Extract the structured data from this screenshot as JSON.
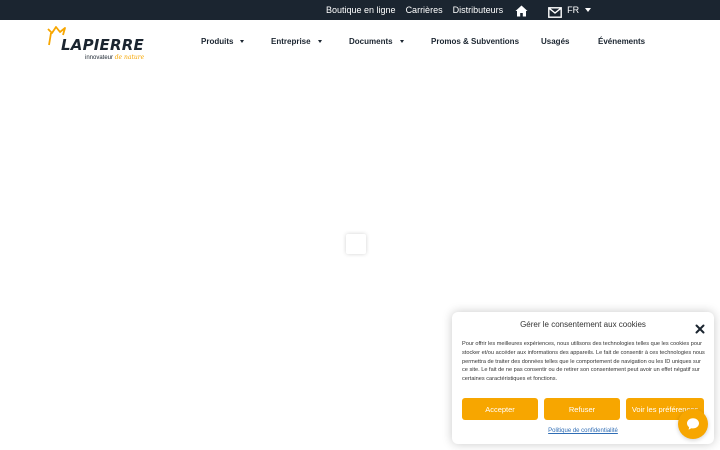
{
  "topbar": {
    "links": [
      "Boutique en ligne",
      "Carrières",
      "Distributeurs"
    ],
    "home_icon": "home-icon",
    "mail_icon": "mail-icon",
    "language": "FR",
    "language_caret_icon": "caret-down-icon"
  },
  "header": {
    "logo": {
      "name": "LAPIERRE",
      "tagline_prefix": "innovateur",
      "tagline_accent": "de nature"
    },
    "nav": {
      "produits": "Produits",
      "entreprise": "Entreprise",
      "documents": "Documents",
      "promos": "Promos & Subventions",
      "usages": "Usagés",
      "evenements": "Événements"
    }
  },
  "cookie_banner": {
    "title": "Gérer le consentement aux cookies",
    "body": "Pour offrir les meilleures expériences, nous utilisons des technologies telles que les cookies pour stocker et/ou accéder aux informations des appareils. Le fait de consentir à ces technologies nous permettra de traiter des données telles que le comportement de navigation ou les ID uniques sur ce site. Le fait de ne pas consentir ou de retirer son consentement peut avoir un effet négatif sur certaines caractéristiques et fonctions.",
    "accept_label": "Accepter",
    "refuse_label": "Refuser",
    "preferences_label": "Voir les préférences",
    "privacy_link": "Politique de confidentialité"
  },
  "colors": {
    "topbar_bg": "#1b2530",
    "accent": "#f7a600",
    "link": "#2f6db5"
  }
}
